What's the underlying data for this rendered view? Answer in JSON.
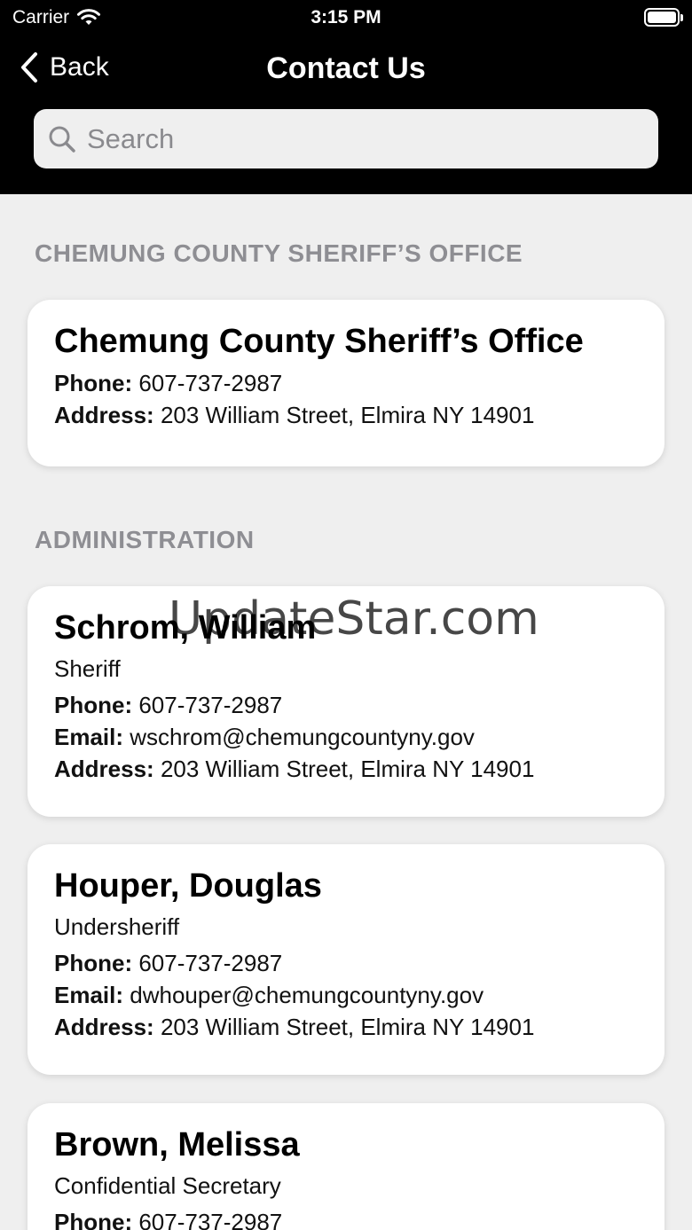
{
  "status_bar": {
    "carrier": "Carrier",
    "time": "3:15 PM"
  },
  "nav": {
    "back_label": "Back",
    "title": "Contact Us"
  },
  "search": {
    "placeholder": "Search",
    "value": ""
  },
  "sections": [
    {
      "header": "CHEMUNG COUNTY SHERIFF’S OFFICE",
      "cards": [
        {
          "name": "Chemung County Sheriff’s Office",
          "phone_label": "Phone:",
          "phone": "607-737-2987",
          "address_label": "Address:",
          "address": "203 William Street, Elmira NY 14901"
        }
      ]
    },
    {
      "header": "ADMINISTRATION",
      "cards": [
        {
          "name": "Schrom, William",
          "role": "Sheriff",
          "phone_label": "Phone:",
          "phone": "607-737-2987",
          "email_label": "Email:",
          "email": "wschrom@chemungcountyny.gov",
          "address_label": "Address:",
          "address": "203 William Street, Elmira NY 14901"
        },
        {
          "name": "Houper, Douglas",
          "role": "Undersheriff",
          "phone_label": "Phone:",
          "phone": "607-737-2987",
          "email_label": "Email:",
          "email": "dwhouper@chemungcountyny.gov",
          "address_label": "Address:",
          "address": "203 William Street, Elmira NY 14901"
        },
        {
          "name": "Brown, Melissa",
          "role": "Confidential Secretary",
          "phone_label": "Phone:",
          "phone": "607-737-2987"
        }
      ]
    }
  ],
  "watermark": "UpdateStar.com",
  "icons": {
    "wifi": "wifi-icon",
    "battery": "battery-icon",
    "back": "chevron-left-icon",
    "search": "search-icon"
  }
}
